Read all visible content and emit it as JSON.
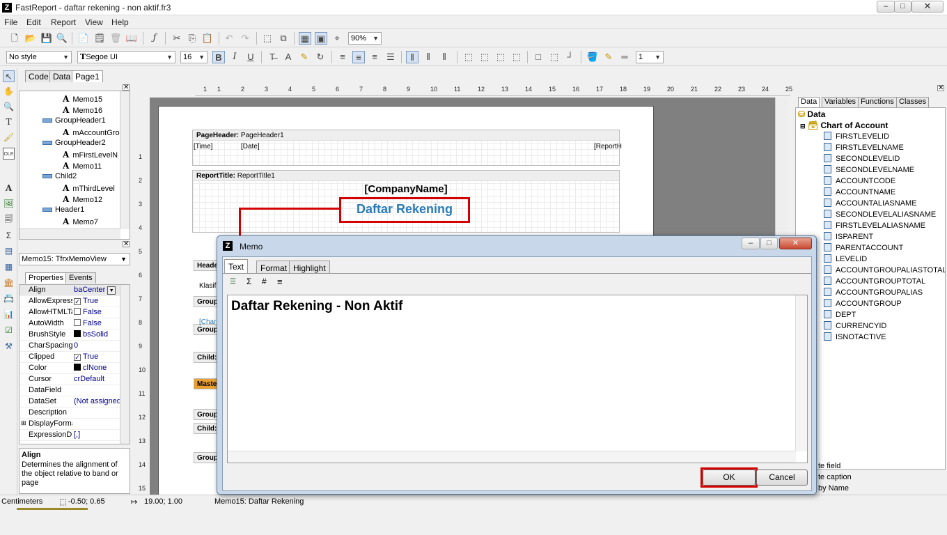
{
  "window": {
    "title": "FastReport - daftar rekening - non aktif.fr3",
    "logo": "Z",
    "controls": [
      "minimize-icon",
      "maximize-icon",
      "close-icon"
    ]
  },
  "menu": [
    "File",
    "Edit",
    "Report",
    "View",
    "Help"
  ],
  "toolbar": {
    "zoom": "90%"
  },
  "formatbar": {
    "style": "No style",
    "font": "Segoe UI",
    "size": "16",
    "line_width": "1"
  },
  "page_tabs": [
    "Code",
    "Data",
    "Page1"
  ],
  "tree": [
    {
      "label": "Memo15",
      "kind": "memo",
      "indent": 2
    },
    {
      "label": "Memo16",
      "kind": "memo",
      "indent": 2
    },
    {
      "label": "GroupHeader1",
      "kind": "band",
      "indent": 1
    },
    {
      "label": "mAccountGro",
      "kind": "memo",
      "indent": 2
    },
    {
      "label": "GroupHeader2",
      "kind": "band",
      "indent": 1
    },
    {
      "label": "mFirstLevelN",
      "kind": "memo",
      "indent": 2
    },
    {
      "label": "Memo11",
      "kind": "memo",
      "indent": 2
    },
    {
      "label": "Child2",
      "kind": "band",
      "indent": 1
    },
    {
      "label": "mThirdLevel",
      "kind": "memo",
      "indent": 2
    },
    {
      "label": "Memo12",
      "kind": "memo",
      "indent": 2
    },
    {
      "label": "Header1",
      "kind": "band",
      "indent": 1
    },
    {
      "label": "Memo7",
      "kind": "memo",
      "indent": 2
    }
  ],
  "object_combo": "Memo15: TfrxMemoView",
  "inspector_tabs": [
    "Properties",
    "Events"
  ],
  "properties": [
    {
      "name": "Align",
      "value": "baCenter",
      "type": "dropdown"
    },
    {
      "name": "AllowExpress",
      "value": "True",
      "type": "check",
      "checked": true
    },
    {
      "name": "AllowHTMLTa",
      "value": "False",
      "type": "check",
      "checked": false
    },
    {
      "name": "AutoWidth",
      "value": "False",
      "type": "check",
      "checked": false
    },
    {
      "name": "BrushStyle",
      "value": "bsSolid",
      "type": "color"
    },
    {
      "name": "CharSpacing",
      "value": "0",
      "type": "text"
    },
    {
      "name": "Clipped",
      "value": "True",
      "type": "check",
      "checked": true
    },
    {
      "name": "Color",
      "value": "clNone",
      "type": "color"
    },
    {
      "name": "Cursor",
      "value": "crDefault",
      "type": "text"
    },
    {
      "name": "DataField",
      "value": "",
      "type": "text"
    },
    {
      "name": "DataSet",
      "value": "(Not assigned",
      "type": "text"
    },
    {
      "name": "Description",
      "value": "",
      "type": "text"
    },
    {
      "name": "DisplayForma",
      "value": "",
      "type": "expand"
    },
    {
      "name": "ExpressionDe",
      "value": "[,]",
      "type": "text"
    }
  ],
  "help": {
    "title": "Align",
    "text": "Determines the alignment of the object relative to band or page"
  },
  "ruler_top": [
    "1",
    "1",
    "2",
    "3",
    "4",
    "5",
    "6",
    "7",
    "8",
    "9",
    "10",
    "11",
    "12",
    "13",
    "14",
    "15",
    "16",
    "17",
    "18",
    "19",
    "20",
    "21",
    "22",
    "23",
    "24",
    "25"
  ],
  "ruler_left": [
    "1",
    "2",
    "3",
    "4",
    "5",
    "6",
    "7",
    "8",
    "9",
    "10",
    "11",
    "12",
    "13",
    "14",
    "15"
  ],
  "bands": {
    "page_header": {
      "type": "PageHeader:",
      "name": "PageHeader1",
      "fields": [
        "[Time]",
        "[Date]",
        "[ReportH"
      ]
    },
    "report_title": {
      "type": "ReportTitle:",
      "name": "ReportTitle1",
      "company": "[CompanyName]",
      "title": "Daftar Rekening"
    },
    "side_headers": [
      "Heade",
      "Group",
      "Group",
      "Child:",
      "Maste",
      "Group",
      "Child:",
      "Group"
    ],
    "side_texts": [
      "Klasifi",
      "[Char"
    ]
  },
  "data_tabs": [
    "Data",
    "Variables",
    "Functions",
    "Classes"
  ],
  "data_tree": {
    "root": "Data",
    "dataset": "Chart of Account",
    "fields": [
      "FIRSTLEVELID",
      "FIRSTLEVELNAME",
      "SECONDLEVELID",
      "SECONDLEVELNAME",
      "ACCOUNTCODE",
      "ACCOUNTNAME",
      "ACCOUNTALIASNAME",
      "SECONDLEVELALIASNAME",
      "FIRSTLEVELALIASNAME",
      "ISPARENT",
      "PARENTACCOUNT",
      "LEVELID",
      "ACCOUNTGROUPALIASTOTAL",
      "ACCOUNTGROUPTOTAL",
      "ACCOUNTGROUPALIAS",
      "ACCOUNTGROUP",
      "DEPT",
      "CURRENCYID",
      "ISNOTACTIVE"
    ]
  },
  "data_options": [
    "te field",
    "te caption",
    "by Name"
  ],
  "status": {
    "units": "Centimeters",
    "pos": "-0.50; 0.65",
    "size": "19.00; 1.00",
    "object": "Memo15: Daftar Rekening"
  },
  "memo_dialog": {
    "title": "Memo",
    "tabs": [
      "Text",
      "Format",
      "Highlight"
    ],
    "text": "Daftar Rekening - Non Aktif",
    "ok": "OK",
    "cancel": "Cancel"
  }
}
